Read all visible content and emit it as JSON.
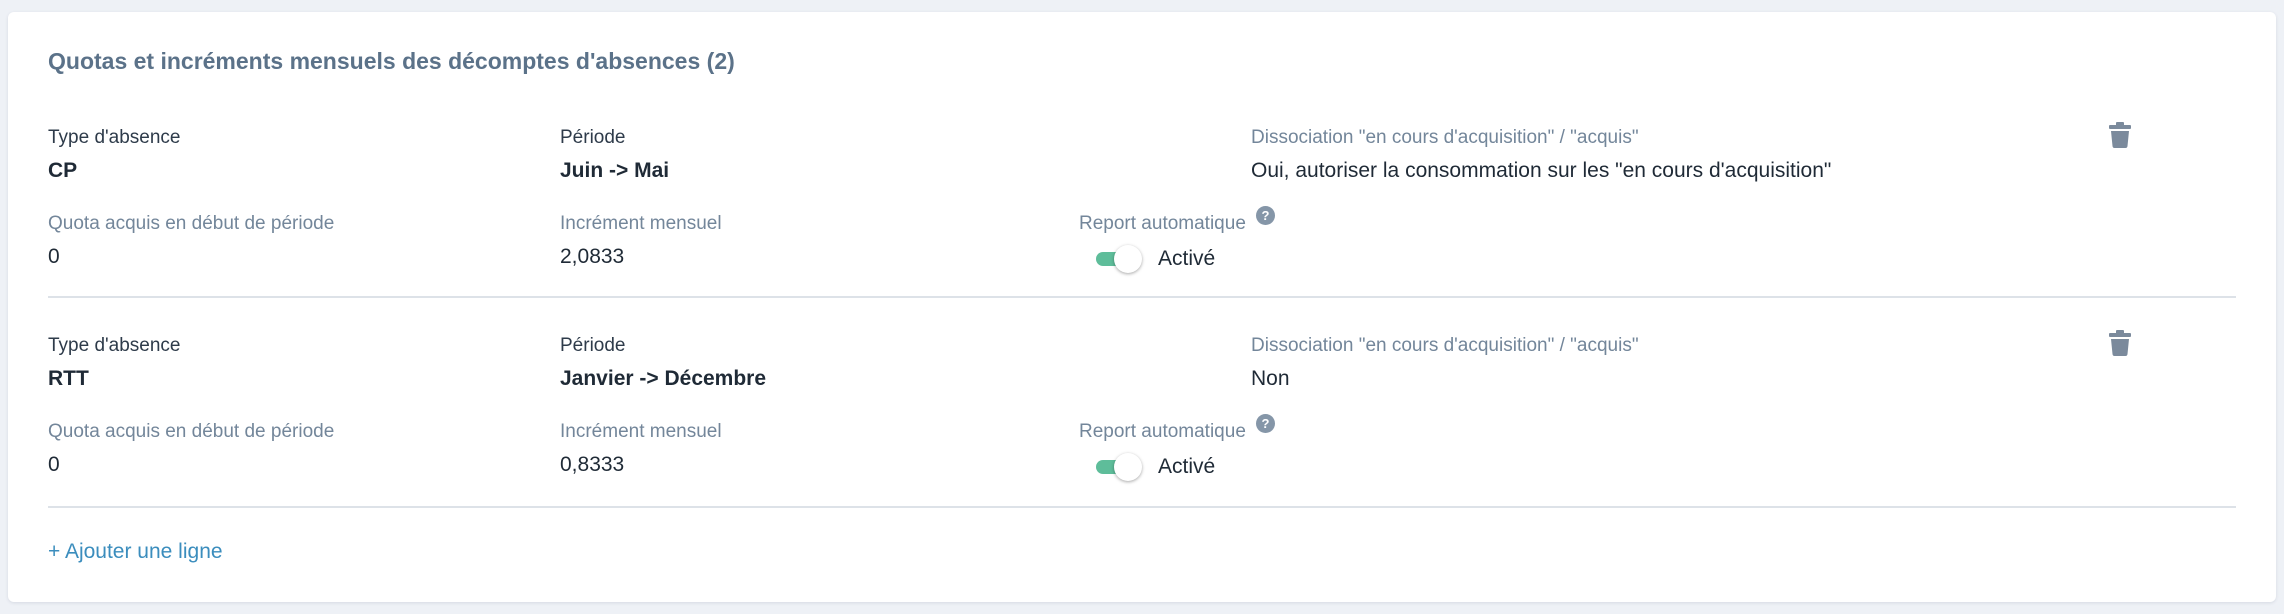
{
  "section": {
    "title": "Quotas et incréments mensuels des décomptes d'absences (2)"
  },
  "labels": {
    "type": "Type d'absence",
    "period": "Période",
    "dissociation": "Dissociation \"en cours d'acquisition\" / \"acquis\"",
    "quota": "Quota acquis en début de période",
    "increment": "Incrément mensuel",
    "report": "Report automatique",
    "help_glyph": "?"
  },
  "rows": [
    {
      "type": "CP",
      "period": "Juin -> Mai",
      "dissociation": "Oui, autoriser la consommation sur les \"en cours d'acquisition\"",
      "quota": "0",
      "increment": "2,0833",
      "report_enabled": true,
      "report_state": "Activé"
    },
    {
      "type": "RTT",
      "period": "Janvier -> Décembre",
      "dissociation": "Non",
      "quota": "0",
      "increment": "0,8333",
      "report_enabled": true,
      "report_state": "Activé"
    }
  ],
  "actions": {
    "add_line": "+ Ajouter une ligne"
  },
  "icons": {
    "delete": "trash-icon",
    "help": "help-icon"
  },
  "colors": {
    "title": "#5b7289",
    "toggle_on": "#5ebd9a",
    "link": "#3b8dbd",
    "icon": "#8596a8"
  }
}
